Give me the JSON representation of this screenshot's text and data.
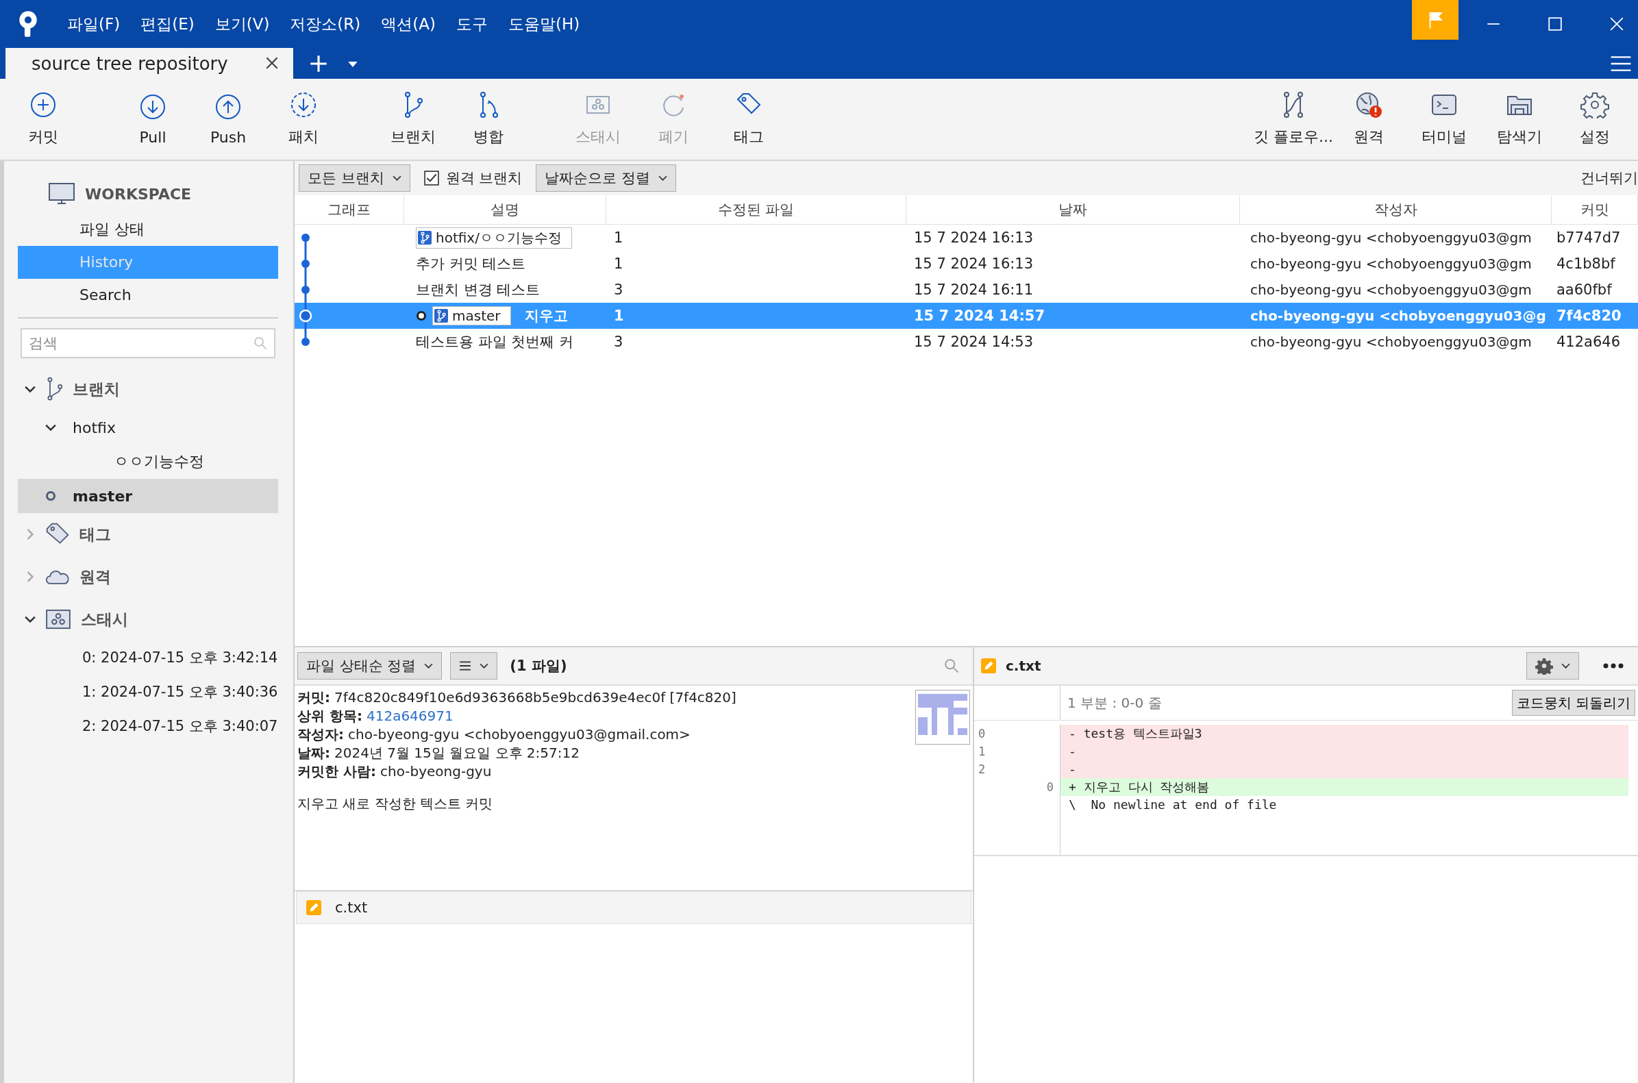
{
  "menu": [
    "파일(F)",
    "편집(E)",
    "보기(V)",
    "저장소(R)",
    "액션(A)",
    "도구",
    "도움말(H)"
  ],
  "tab": {
    "title": "source tree repository"
  },
  "toolbar": {
    "groups": [
      [
        {
          "label": "커밋",
          "disabled": false
        }
      ],
      [
        {
          "label": "Pull",
          "disabled": false
        },
        {
          "label": "Push",
          "disabled": false
        },
        {
          "label": "패치",
          "disabled": false
        }
      ],
      [
        {
          "label": "브랜치",
          "disabled": false
        },
        {
          "label": "병합",
          "disabled": false
        }
      ],
      [
        {
          "label": "스태시",
          "disabled": true
        },
        {
          "label": "폐기",
          "disabled": true
        },
        {
          "label": "태그",
          "disabled": false
        }
      ]
    ],
    "right": [
      {
        "label": "깃 플로우...",
        "disabled": false
      },
      {
        "label": "원격",
        "disabled": false
      },
      {
        "label": "터미널",
        "disabled": false
      },
      {
        "label": "탐색기",
        "disabled": false
      },
      {
        "label": "설정",
        "disabled": false
      }
    ]
  },
  "sidebar": {
    "workspace": "WORKSPACE",
    "items": [
      {
        "label": "파일 상태",
        "selected": false
      },
      {
        "label": "History",
        "selected": true
      },
      {
        "label": "Search",
        "selected": false
      }
    ],
    "search": {
      "placeholder": "검색"
    },
    "sections": [
      {
        "kind": "branches",
        "label": "브랜치",
        "expanded": true,
        "children": [
          {
            "label": "hotfix",
            "current": false,
            "selected": false,
            "expanded": true,
            "children": [
              {
                "label": "ㅇㅇ기능수정",
                "current": false,
                "selected": false
              }
            ]
          },
          {
            "label": "master",
            "current": true,
            "selected": true
          }
        ]
      },
      {
        "kind": "tags",
        "label": "태그",
        "expanded": false
      },
      {
        "kind": "remotes",
        "label": "원격",
        "expanded": false
      },
      {
        "kind": "stashes",
        "label": "스태시",
        "expanded": true,
        "children": [
          {
            "label": "0: 2024-07-15 오후 3:42:14"
          },
          {
            "label": "1: 2024-07-15 오후 3:40:36"
          },
          {
            "label": "2: 2024-07-15 오후 3:40:07"
          }
        ]
      }
    ]
  },
  "history": {
    "branch_filter": "모든 브랜치",
    "remote_branches": {
      "label": "원격 브랜치",
      "checked": true
    },
    "sort": "날짜순으로 정렬",
    "skip": "건너뛰기",
    "columns": [
      "그래프",
      "설명",
      "수정된 파일",
      "날짜",
      "작성자",
      "커밋"
    ],
    "rows": [
      {
        "refs": [
          {
            "label": "hotfix/ㅇㅇ기능수정",
            "current": false
          }
        ],
        "files": "1",
        "date": "15 7 2024 16:13",
        "author": "cho-byeong-gyu <chobyoenggyu03@gm",
        "commit": "b7747d7",
        "selected": false
      },
      {
        "refs": [],
        "description": "추가 커밋 테스트",
        "files": "1",
        "date": "15 7 2024 16:13",
        "author": "cho-byeong-gyu <chobyoenggyu03@gm",
        "commit": "4c1b8bf",
        "selected": false
      },
      {
        "refs": [],
        "description": "브랜치 변경 테스트",
        "files": "3",
        "date": "15 7 2024 16:11",
        "author": "cho-byeong-gyu <chobyoenggyu03@gm",
        "commit": "aa60fbf",
        "selected": false
      },
      {
        "refs": [
          {
            "label": "master",
            "current": true
          }
        ],
        "description": "지우고",
        "files": "1",
        "date": "15 7 2024 14:57",
        "author": "cho-byeong-gyu <chobyoenggyu03@g",
        "commit": "7f4c820",
        "selected": true
      },
      {
        "refs": [],
        "description": "테스트용 파일 첫번째 커",
        "files": "3",
        "date": "15 7 2024 14:53",
        "author": "cho-byeong-gyu <chobyoenggyu03@gm",
        "commit": "412a646",
        "selected": false
      }
    ]
  },
  "details": {
    "sort": "파일 상태순 정렬",
    "file_count": "(1 파일)",
    "fields": [
      {
        "label": "커밋:",
        "value": "7f4c820c849f10e6d9363668b5e9bcd639e4ec0f [7f4c820]",
        "kind": "text"
      },
      {
        "label": "상위 항목:",
        "value": "412a646971",
        "kind": "link"
      },
      {
        "label": "작성자:",
        "value": "cho-byeong-gyu <chobyoenggyu03@gmail.com>",
        "kind": "text"
      },
      {
        "label": "날짜:",
        "value": "2024년 7월 15일 월요일 오후 2:57:12",
        "kind": "text"
      },
      {
        "label": "커밋한 사람:",
        "value": "cho-byeong-gyu",
        "kind": "text"
      }
    ],
    "message": "지우고 새로 작성한 텍스트 커밋",
    "files": [
      {
        "name": "c.txt"
      }
    ]
  },
  "diff": {
    "file": "c.txt",
    "hunk": "1 부분 : 0-0 줄",
    "revert_button": "코드뭉치 되돌리기",
    "lines": [
      {
        "kind": "removed",
        "old": "0",
        "text": "- test용 텍스트파일3"
      },
      {
        "kind": "removed",
        "old": "1",
        "text": "-"
      },
      {
        "kind": "removed",
        "old": "2",
        "text": "-"
      },
      {
        "kind": "added",
        "new": "0",
        "text": "+ 지우고 다시 작성해봄"
      },
      {
        "kind": "context",
        "text": "\\  No newline at end of file"
      }
    ]
  }
}
